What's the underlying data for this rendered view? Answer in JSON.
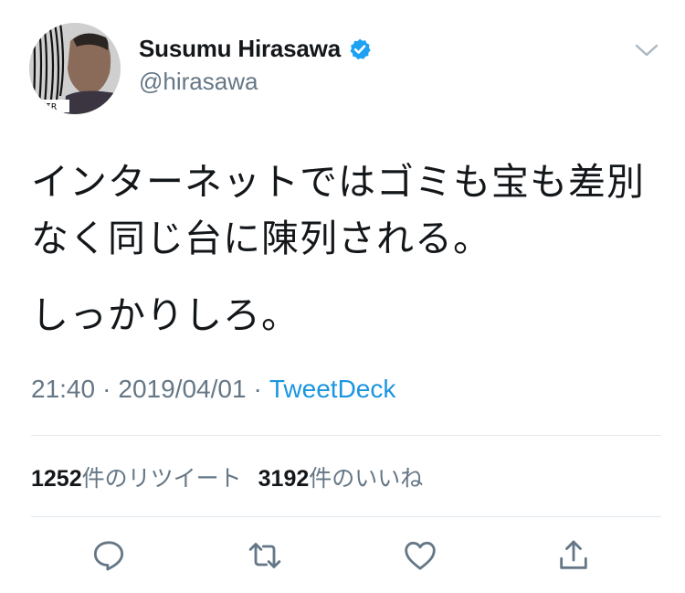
{
  "author": {
    "display_name": "Susumu Hirasawa",
    "handle": "@hirasawa",
    "verified": true,
    "avatar_text": "HIR"
  },
  "tweet": {
    "paragraphs": [
      "インターネットではゴミも宝も差別なく同じ台に陳列される。",
      "しっかりしろ。"
    ]
  },
  "meta": {
    "time": "21:40",
    "separator": "·",
    "date": "2019/04/01",
    "source": "TweetDeck"
  },
  "stats": {
    "retweets_count": "1252",
    "retweets_label": "件のリツイート",
    "likes_count": "3192",
    "likes_label": "件のいいね"
  },
  "actions": [
    "reply-icon",
    "retweet-icon",
    "like-icon",
    "share-icon"
  ],
  "colors": {
    "text": "#14171a",
    "muted": "#657786",
    "link": "#1b95e0",
    "divider": "#e1e8ed",
    "verified": "#1da1f2"
  }
}
